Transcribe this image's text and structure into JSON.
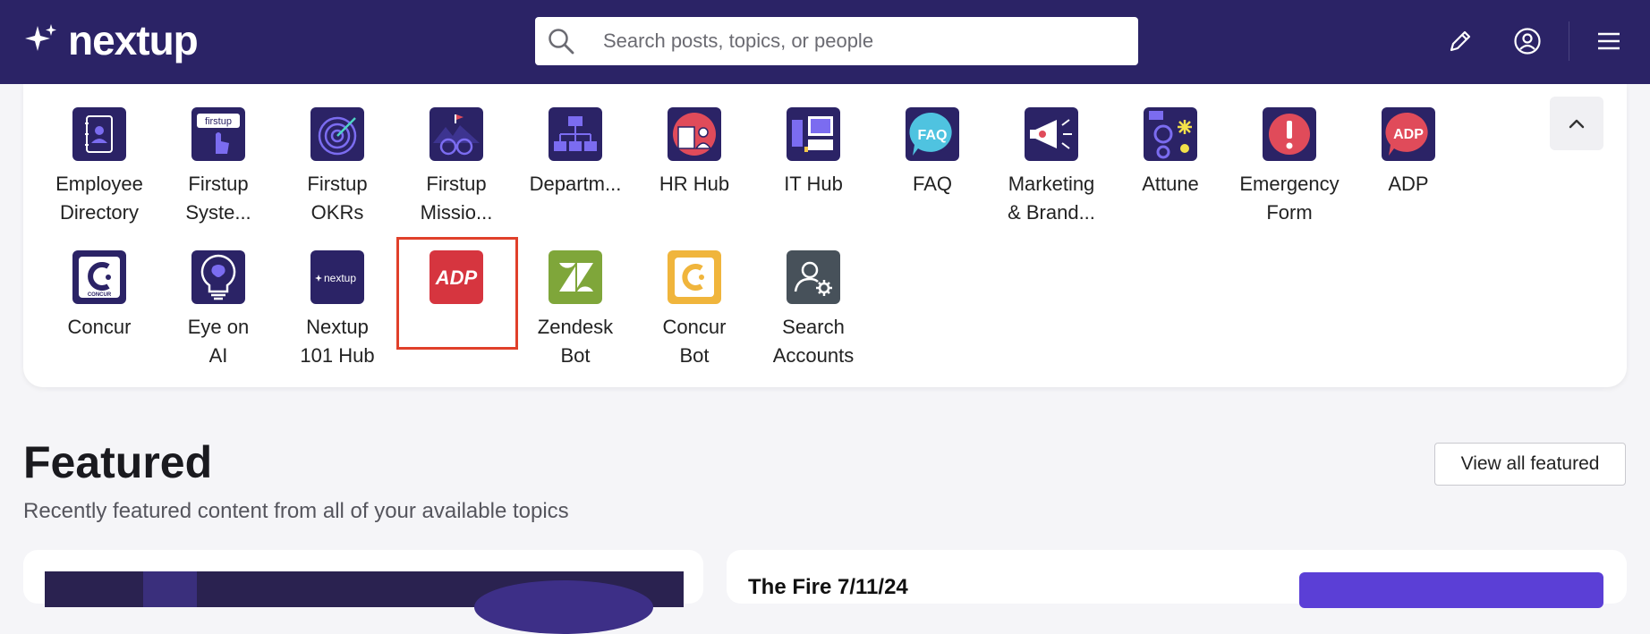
{
  "header": {
    "logo_text": "nextup",
    "search_placeholder": "Search posts, topics, or people"
  },
  "apps": [
    {
      "label_lines": [
        "Employee",
        "Directory"
      ],
      "icon": "contact-book-icon"
    },
    {
      "label_lines": [
        "Firstup",
        "Syste..."
      ],
      "icon": "firstup-touch-icon"
    },
    {
      "label_lines": [
        "Firstup",
        "OKRs"
      ],
      "icon": "target-icon"
    },
    {
      "label_lines": [
        "Firstup",
        "Missio..."
      ],
      "icon": "binoculars-icon"
    },
    {
      "label_lines": [
        "Departm..."
      ],
      "icon": "org-chart-icon"
    },
    {
      "label_lines": [
        "HR Hub"
      ],
      "icon": "hr-people-icon"
    },
    {
      "label_lines": [
        "IT Hub"
      ],
      "icon": "it-devices-icon"
    },
    {
      "label_lines": [
        "FAQ"
      ],
      "icon": "faq-bubble-icon"
    },
    {
      "label_lines": [
        "Marketing",
        "& Brand..."
      ],
      "icon": "megaphone-icon"
    },
    {
      "label_lines": [
        "Attune"
      ],
      "icon": "attune-icon"
    },
    {
      "label_lines": [
        "Emergency",
        "Form"
      ],
      "icon": "alert-icon"
    },
    {
      "label_lines": [
        "ADP"
      ],
      "icon": "adp-bubble-icon"
    },
    {
      "label_lines": [
        "Concur"
      ],
      "icon": "concur-icon"
    },
    {
      "label_lines": [
        "Eye on",
        "AI"
      ],
      "icon": "lightbulb-brain-icon"
    },
    {
      "label_lines": [
        "Nextup",
        "101 Hub"
      ],
      "icon": "nextup-logo-icon"
    },
    {
      "label_lines": [],
      "icon": "adp-logo-icon"
    },
    {
      "label_lines": [
        "Zendesk",
        "Bot"
      ],
      "icon": "zendesk-icon"
    },
    {
      "label_lines": [
        "Concur",
        "Bot"
      ],
      "icon": "concur-bot-icon"
    },
    {
      "label_lines": [
        "Search",
        "Accounts"
      ],
      "icon": "user-gear-icon"
    }
  ],
  "icon_text": {
    "firstup": "firstup",
    "faq": "FAQ",
    "adp": "ADP",
    "concur_small": "CONCUR",
    "nextup_small": "nextup",
    "adp_logo": "ADP"
  },
  "featured": {
    "title": "Featured",
    "subtitle": "Recently featured content from all of your available topics",
    "view_all_label": "View all featured"
  },
  "post_preview": {
    "title": "The Fire 7/11/24"
  },
  "colors": {
    "header_bg": "#2b2366",
    "highlight": "#e0402a",
    "accent": "#5b3fd6"
  }
}
